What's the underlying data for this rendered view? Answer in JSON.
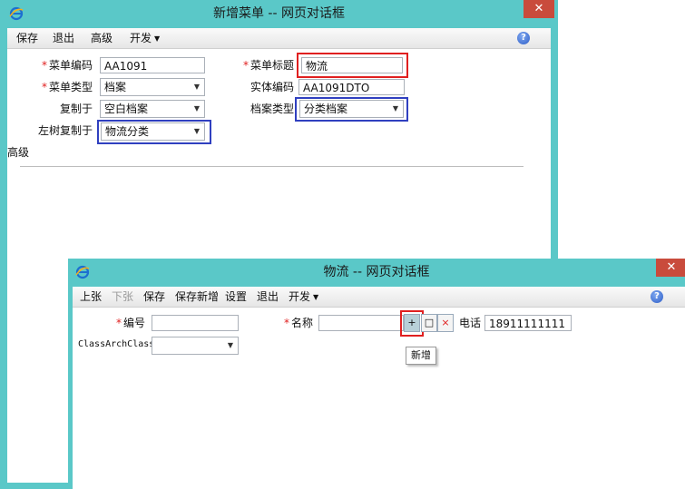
{
  "colors": {
    "frame": "#5ac8c8",
    "close": "#c94b3c",
    "highlight_red": "#e02020",
    "highlight_blue": "#3040c0",
    "required": "#e02020"
  },
  "win1": {
    "title": "新增菜单 -- 网页对话框",
    "menu": {
      "save": "保存",
      "exit": "退出",
      "advanced": "高级",
      "develop": "开发",
      "help_icon": "help-icon"
    },
    "form": {
      "menu_code": {
        "label": "菜单编码",
        "value": "AA1091"
      },
      "menu_title": {
        "label": "菜单标题",
        "value": "物流"
      },
      "menu_type": {
        "label": "菜单类型",
        "value": "档案"
      },
      "entity_code": {
        "label": "实体编码",
        "value": "AA1091DTO"
      },
      "copy_from": {
        "label": "复制于",
        "value": "空白档案"
      },
      "archive_type": {
        "label": "档案类型",
        "value": "分类档案"
      },
      "left_tree_copy": {
        "label": "左树复制于",
        "value": "物流分类"
      }
    },
    "advanced_section": "高级"
  },
  "win2": {
    "title": "物流 -- 网页对话框",
    "menu": {
      "prev": "上张",
      "next": "下张",
      "save": "保存",
      "save_new": "保存新增",
      "settings": "设置",
      "exit": "退出",
      "develop": "开发"
    },
    "form": {
      "code": {
        "label": "编号",
        "value": ""
      },
      "name": {
        "label": "名称",
        "value": ""
      },
      "phone": {
        "label": "电话",
        "value": "18911111111"
      },
      "class_arch": {
        "label": "ClassArchClass",
        "value": ""
      }
    },
    "buttons": {
      "add": "+",
      "edit": "□",
      "delete": "×"
    },
    "tooltip": "新增"
  }
}
